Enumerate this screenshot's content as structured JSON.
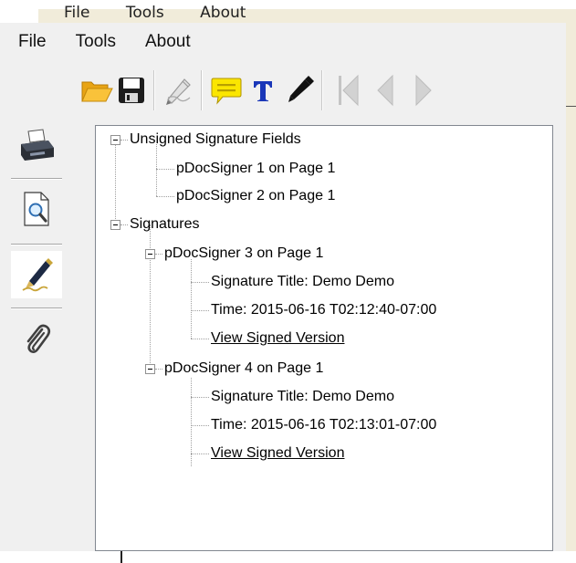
{
  "background_window": {
    "menu": [
      "File",
      "Tools",
      "About"
    ]
  },
  "menu": {
    "file": "File",
    "tools": "Tools",
    "about": "About"
  },
  "toolbar": {
    "buttons": [
      "open-folder-icon",
      "save-icon",
      "sign-icon",
      "comment-icon",
      "text-icon",
      "pen-icon",
      "first-page-icon",
      "previous-page-icon",
      "next-page-icon"
    ]
  },
  "sidebar": {
    "buttons": [
      "printer-icon",
      "preview-magnifier-icon",
      "signature-pen-icon",
      "attachment-paperclip-icon"
    ],
    "active": "signature-pen-icon"
  },
  "tree": {
    "unsigned_header": "Unsigned Signature Fields",
    "unsigned": [
      "pDocSigner 1 on Page 1",
      "pDocSigner 2 on Page 1"
    ],
    "signatures_header": "Signatures",
    "signatures": [
      {
        "name": "pDocSigner 3 on Page 1",
        "title": "Signature Title: Demo Demo",
        "time": "Time: 2015-06-16 T02:12:40-07:00",
        "link": "View Signed Version"
      },
      {
        "name": "pDocSigner 4 on Page 1",
        "title": "Signature Title: Demo Demo",
        "time": "Time: 2015-06-16 T02:13:01-07:00",
        "link": "View Signed Version"
      }
    ]
  },
  "colors": {
    "window_bg": "#f0f0f0",
    "background_window": "#f1ecda",
    "tree_border": "#828790",
    "folder": "#f5b21b",
    "comment": "#f6e400",
    "text_tool": "#1a37b8"
  }
}
